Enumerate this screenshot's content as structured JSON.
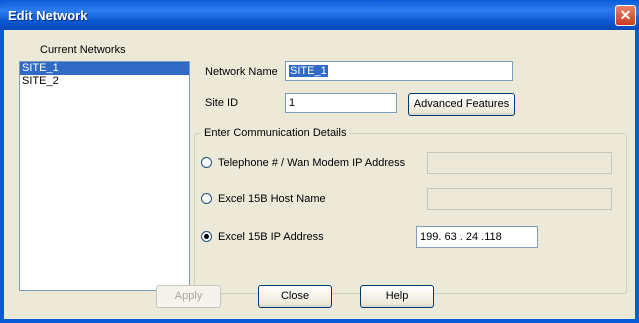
{
  "window": {
    "title": "Edit Network",
    "close_glyph": "✕"
  },
  "networks": {
    "label": "Current Networks",
    "items": [
      {
        "label": "SITE_1",
        "selected": true
      },
      {
        "label": "SITE_2",
        "selected": false
      }
    ]
  },
  "form": {
    "network_name_label": "Network Name",
    "network_name_value": "SITE_1",
    "site_id_label": "Site ID",
    "site_id_value": "1",
    "advanced_button": "Advanced Features"
  },
  "comm": {
    "group_label": "Enter Communication Details",
    "options": [
      {
        "label": "Telephone # / Wan Modem IP Address",
        "checked": false,
        "value": ""
      },
      {
        "label": "Excel 15B Host Name",
        "checked": false,
        "value": ""
      },
      {
        "label": "Excel 15B IP Address",
        "checked": true,
        "value": "199. 63 . 24 .118"
      }
    ]
  },
  "buttons": {
    "apply": "Apply",
    "close": "Close",
    "help": "Help"
  },
  "colors": {
    "titlebar": "#0a5bd8",
    "selection": "#316ac5",
    "dialog_bg": "#ece9d8"
  }
}
